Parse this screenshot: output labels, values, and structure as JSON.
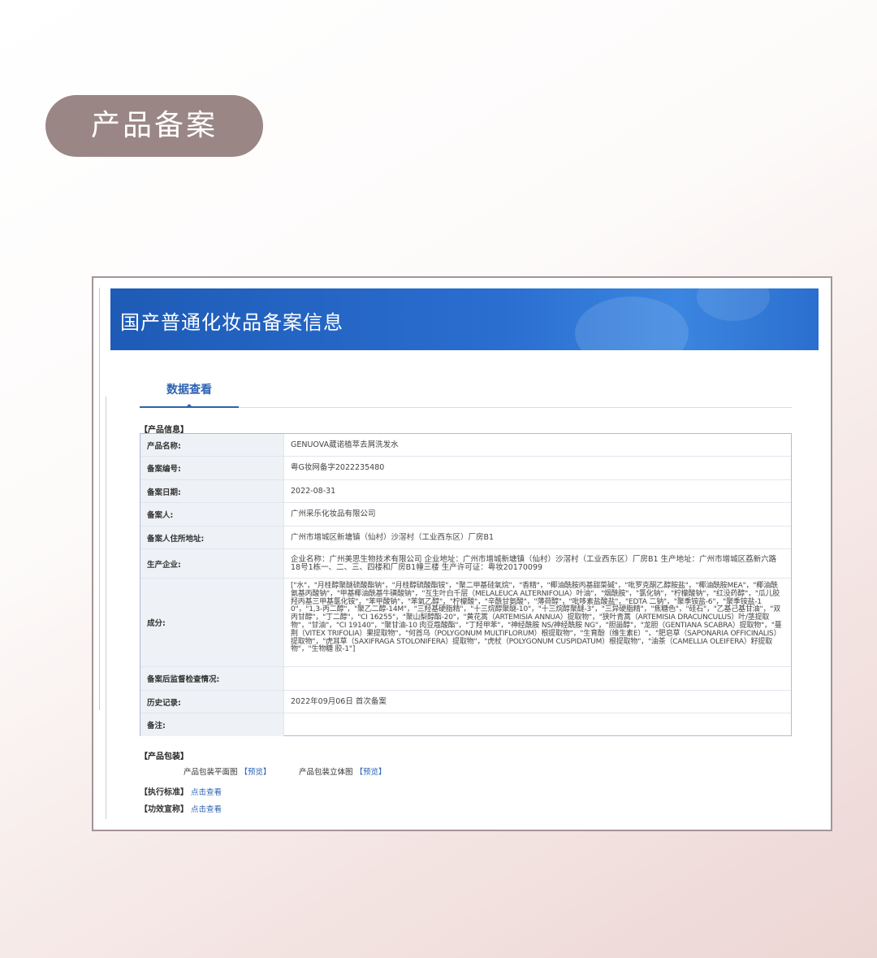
{
  "header": {
    "badge": "产品备案"
  },
  "banner": {
    "title": "国产普通化妆品备案信息"
  },
  "tabs": [
    {
      "label": "数据查看"
    }
  ],
  "product_info": {
    "section_title": "【产品信息】",
    "rows": [
      {
        "label": "产品名称:",
        "value": "GENUOVA葳诺植萃去屑洗发水"
      },
      {
        "label": "备案编号:",
        "value": "粤G妆网备字2022235480"
      },
      {
        "label": "备案日期:",
        "value": "2022-08-31"
      },
      {
        "label": "备案人:",
        "value": "广州采乐化妆品有限公司"
      },
      {
        "label": "备案人住所地址:",
        "value": "广州市增城区新塘镇（仙村）沙滘村（工业西东区）厂房B1"
      },
      {
        "label": "生产企业:",
        "value": "企业名称：广州美思生物技术有限公司 企业地址：广州市增城新塘镇（仙村）沙滘村（工业西东区）厂房B1 生产地址：广州市增城区荔新六路18号1栋一、二、三、四楼和厂房B1幢三楼 生产许可证：粤妆20170099"
      },
      {
        "label": "成分:",
        "value": "[\"水\"，\"月桂醇聚醚硫酸酯钠\"，\"月桂醇硫酸酯铵\"，\"聚二甲基硅氧烷\"，\"香精\"，\"椰油酰胺丙基甜菜碱\"，\"吡罗克酮乙醇胺盐\"，\"椰油酰胺MEA\"，\"椰油酰氨基丙酸钠\"，\"甲基椰油酰基牛磺酸钠\"，\"互生叶白千层（MELALEUCA ALTERNIFOLIA）叶油\"，\"烟酰胺\"，\"氯化钠\"，\"柠檬酸钠\"，\"红没药醇\"，\"瓜儿胶羟丙基三甲基氯化铵\"，\"苯甲酸钠\"，\"苯氧乙醇\"，\"柠檬酸\"，\"辛酰甘氨酸\"，\"薄荷醇\"，\"吡哆素盐酸盐\"，\"EDTA 二钠\"，\"聚季铵盐-6\"，\"聚季铵盐-10\"，\"1,3-丙二醇\"，\"聚乙二醇-14M\"，\"三羟基硬脂精\"，\"十三烷醇聚醚-10\"，\"十三烷醇聚醚-3\"，\"三异硬脂精\"，\"焦糖色\"，\"硅石\"，\"乙基己基甘油\"，\"双丙甘醇\"，\"丁二醇\"，\"CI 16255\"，\"聚山梨醇酯-20\"，\"黄花蒿（ARTEMISIA ANNUA）提取物\"，\"狭叶青蒿（ARTEMISIA DRACUNCULUS）叶/茎提取物\"，\"甘油\"，\"CI 19140\"，\"聚甘油-10 肉豆蔻酸酯\"，\"丁羟甲苯\"，\"神经酰胺 NS/神经酰胺 NG\"，\"胆甾醇\"，\"龙胆（GENTIANA SCABRA）提取物\"，\"蔓荆（VITEX TRIFOLIA）果提取物\"，\"何首乌（POLYGONUM MULTIFLORUM）根提取物\"，\"生育酚（维生素E）\"，\"肥皂草（SAPONARIA OFFICINALIS）提取物\"，\"虎耳草（SAXIFRAGA STOLONIFERA）提取物\"，\"虎杖（POLYGONUM CUSPIDATUM）根提取物\"，\"油茶（CAMELLIA OLEIFERA）籽提取物\"，\"生物糖 胶-1\"]"
      },
      {
        "label": "备案后监督检查情况:",
        "value": ""
      },
      {
        "label": "历史记录:",
        "value": "2022年09月06日 首次备案"
      },
      {
        "label": "备注:",
        "value": ""
      }
    ]
  },
  "packaging": {
    "section_title": "【产品包装】",
    "flat_label": "产品包装平面图",
    "flat_link": "【预览】",
    "stereo_label": "产品包装立体图",
    "stereo_link": "【预览】"
  },
  "standard": {
    "label": "【执行标准】",
    "link": "点击查看"
  },
  "efficacy": {
    "label": "【功效宣称】",
    "link": "点击查看"
  }
}
